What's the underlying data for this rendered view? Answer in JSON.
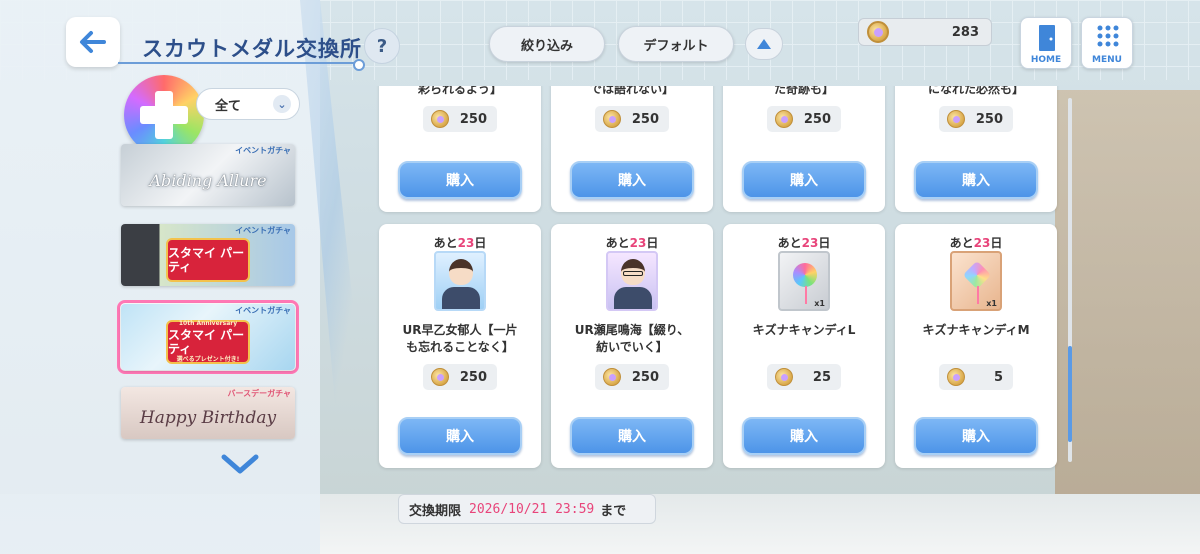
{
  "header": {
    "title": "スカウトメダル交換所",
    "help_label": "?"
  },
  "filter": {
    "category_value": "全て",
    "narrow_label": "絞り込み",
    "sort_label": "デフォルト"
  },
  "banners": [
    {
      "tag": "イベントガチャ",
      "art_text": "Abiding Allure"
    },
    {
      "tag": "イベントガチャ",
      "art_text": "スタマイ パーティ"
    },
    {
      "tag": "イベントガチャ",
      "art_text": "スタマイ パーティ",
      "sub_text": "10th Anniversary",
      "note": "選べるプレゼント付き!"
    },
    {
      "tag": "バースデーガチャ",
      "art_text": "Happy Birthday"
    }
  ],
  "currency": {
    "amount": "283"
  },
  "nav": {
    "home_label": "HOME",
    "menu_label": "MENU"
  },
  "items_row1": [
    {
      "name_tail": "彩られるよう】",
      "price": "250",
      "buy_label": "購入"
    },
    {
      "name_tail": "では語れない】",
      "price": "250",
      "buy_label": "購入"
    },
    {
      "name_tail": "た奇跡も】",
      "price": "250",
      "buy_label": "購入"
    },
    {
      "name_tail": "になれた必然も】",
      "price": "250",
      "buy_label": "購入"
    }
  ],
  "items_row2": [
    {
      "remain_prefix": "あと",
      "remain_days": "23",
      "remain_suffix": "日",
      "name_line1": "UR早乙女郁人【一片",
      "name_line2": "も忘れることなく】",
      "price": "250",
      "buy_label": "購入",
      "qty": ""
    },
    {
      "remain_prefix": "あと",
      "remain_days": "23",
      "remain_suffix": "日",
      "name_line1": "UR瀬尾鳴海【綴り、",
      "name_line2": "紡いでいく】",
      "price": "250",
      "buy_label": "購入",
      "qty": ""
    },
    {
      "remain_prefix": "あと",
      "remain_days": "23",
      "remain_suffix": "日",
      "name_line1": "キズナキャンディL",
      "name_line2": "",
      "price": "25",
      "buy_label": "購入",
      "qty": "x1"
    },
    {
      "remain_prefix": "あと",
      "remain_days": "23",
      "remain_suffix": "日",
      "name_line1": "キズナキャンディM",
      "name_line2": "",
      "price": "5",
      "buy_label": "購入",
      "qty": "x1"
    }
  ],
  "deadline": {
    "label": "交換期限",
    "date": "2026/10/21 23:59",
    "suffix": "まで"
  },
  "colors": {
    "accent": "#4d94e8",
    "highlight": "#e8447a",
    "title": "#2d4f8a"
  }
}
